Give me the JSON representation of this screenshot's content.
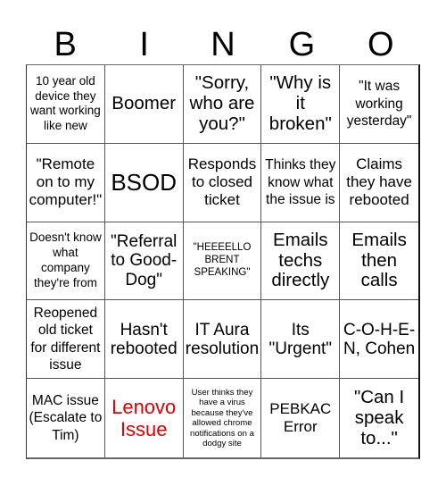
{
  "header": {
    "letters": [
      "B",
      "I",
      "N",
      "G",
      "O"
    ]
  },
  "card": {
    "cells": [
      {
        "text": "10 year old device they want working like new"
      },
      {
        "text": "Boomer"
      },
      {
        "text": "\"Sorry, who are you?\""
      },
      {
        "text": "\"Why is it broken\""
      },
      {
        "text": "\"It was working yesterday\""
      },
      {
        "text": "\"Remote on to my computer!\""
      },
      {
        "text": "BSOD"
      },
      {
        "text": "Responds to closed ticket"
      },
      {
        "text": "Thinks they know what the issue is"
      },
      {
        "text": "Claims they have rebooted"
      },
      {
        "text": "Doesn't know what company they're from"
      },
      {
        "text": "\"Referral to Good-Dog\""
      },
      {
        "text": "\"HEEEELLO BRENT SPEAKING\""
      },
      {
        "text": "Emails techs directly"
      },
      {
        "text": "Emails then calls"
      },
      {
        "text": "Reopened old ticket for different issue"
      },
      {
        "text": "Hasn't rebooted"
      },
      {
        "text": "IT Aura resolution"
      },
      {
        "text": "Its \"Urgent\""
      },
      {
        "text": "C-O-H-E-N, Cohen"
      },
      {
        "text": "MAC issue (Escalate to Tim)"
      },
      {
        "text": "Lenovo Issue",
        "color": "#e00000"
      },
      {
        "text": "User thinks they have a virus because they've allowed chrome notifications on a dodgy site"
      },
      {
        "text": "PEBKAC Error"
      },
      {
        "text": "\"Can I speak to...\""
      }
    ]
  }
}
